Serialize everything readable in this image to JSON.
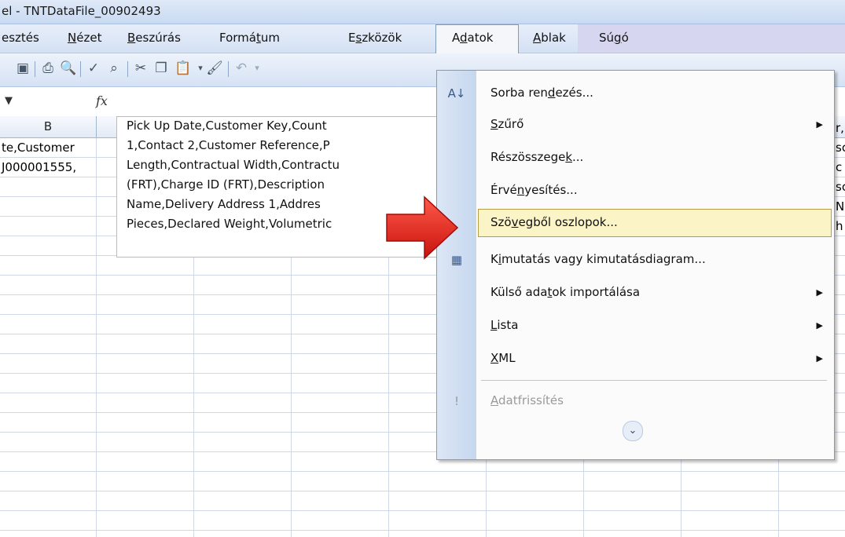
{
  "window": {
    "title": "el - TNTDataFile_00902493"
  },
  "menubar": {
    "items": [
      {
        "pre": "esztés",
        "u": "",
        "post": ""
      },
      {
        "pre": "",
        "u": "N",
        "post": "ézet"
      },
      {
        "pre": "",
        "u": "B",
        "post": "eszúrás"
      },
      {
        "pre": "Formá",
        "u": "t",
        "post": "um"
      },
      {
        "pre": "E",
        "u": "s",
        "post": "zközök"
      },
      {
        "pre": "A",
        "u": "d",
        "post": "atok"
      },
      {
        "pre": "",
        "u": "A",
        "post": "blak"
      },
      {
        "pre": "Sú",
        "u": "g",
        "post": "ó"
      }
    ]
  },
  "formula_bar": {
    "fx": "fx"
  },
  "columns": [
    "B"
  ],
  "cells": {
    "row1": "te,Customer",
    "row2": "J000001555,"
  },
  "tooltip": {
    "lines": [
      "Pick Up Date,Customer Key,Count",
      "1,Contact 2,Customer Reference,P",
      "Length,Contractual Width,Contractu",
      "(FRT),Charge ID (FRT),Description",
      "Name,Delivery Address 1,Addres",
      "Pieces,Declared Weight,Volumetric"
    ]
  },
  "right_edge_text": [
    "r,",
    "sc",
    "c",
    "sc",
    "N",
    "h"
  ],
  "dropdown": {
    "items": [
      {
        "pre": "Sorba ren",
        "u": "d",
        "post": "ezés..."
      },
      {
        "pre": "",
        "u": "S",
        "post": "zűrő"
      },
      {
        "pre": "Részösszege",
        "u": "k",
        "post": "..."
      },
      {
        "pre": "Érvé",
        "u": "n",
        "post": "yesítés..."
      },
      {
        "pre": "Szö",
        "u": "v",
        "post": "egből oszlopok..."
      },
      {
        "pre": "K",
        "u": "i",
        "post": "mutatás vagy kimutatásdiagram..."
      },
      {
        "pre": "Külső ada",
        "u": "t",
        "post": "ok importálása"
      },
      {
        "pre": "",
        "u": "L",
        "post": "ista"
      },
      {
        "pre": "",
        "u": "X",
        "post": "ML"
      },
      {
        "pre": "",
        "u": "A",
        "post": "datfrissítés"
      }
    ],
    "expand_icon": "double-chevron-down-icon"
  },
  "colors": {
    "highlight": "#fbf4c6",
    "highlight_border": "#b59d45",
    "arrow": "#e3261b"
  }
}
